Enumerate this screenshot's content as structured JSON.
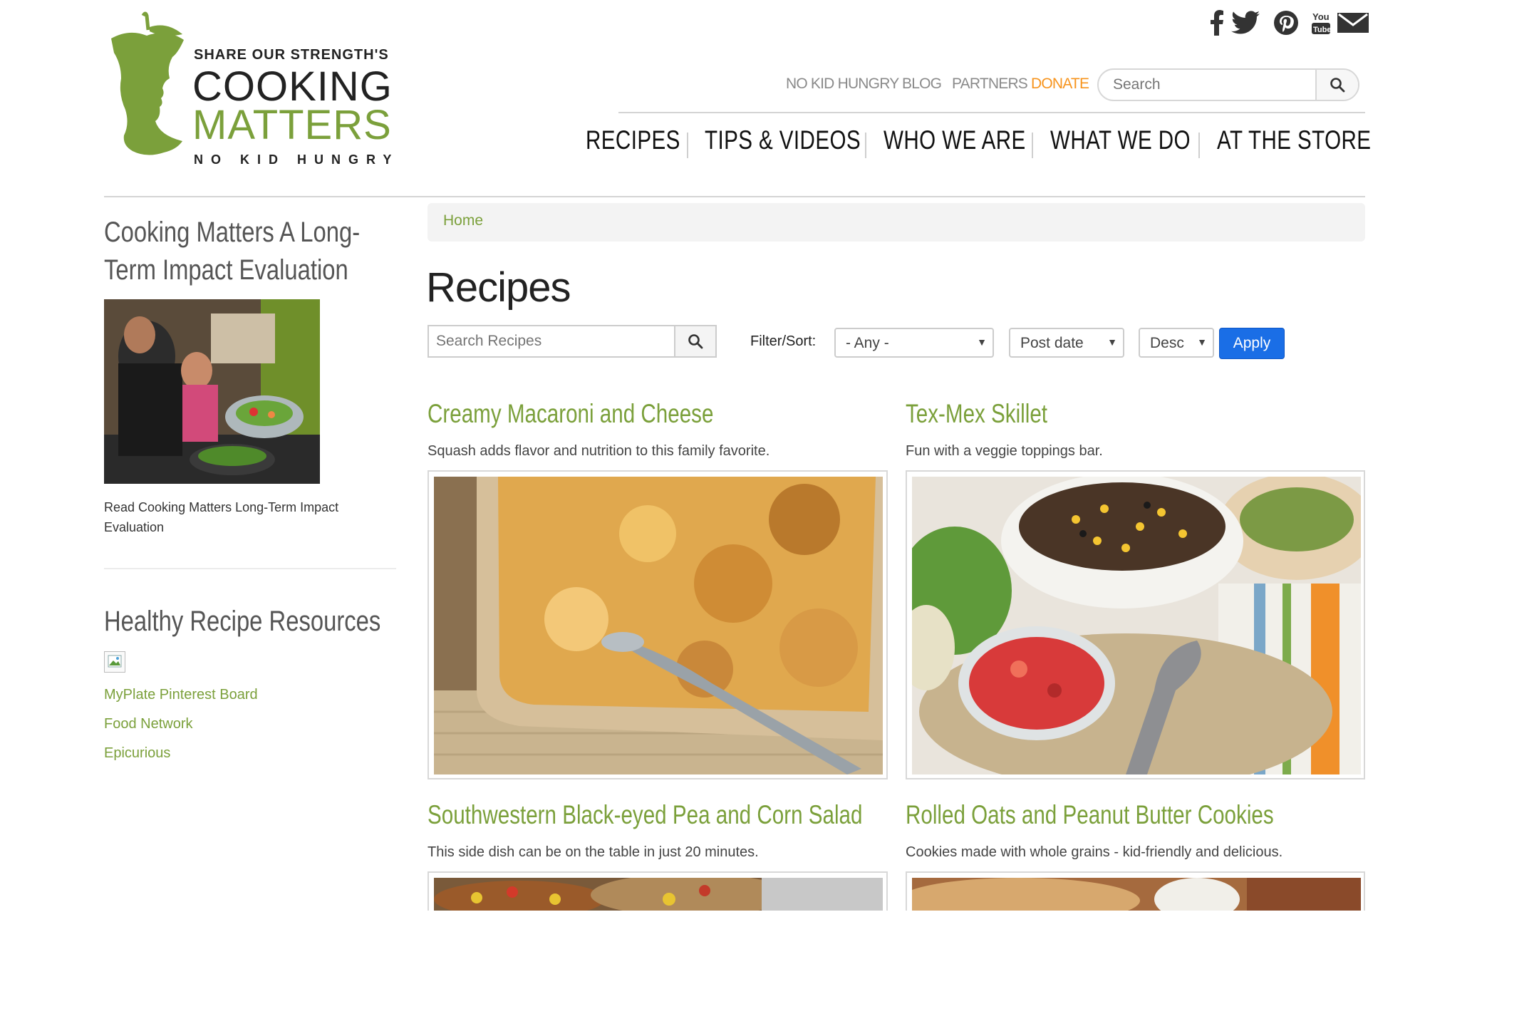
{
  "brand": {
    "line1": "SHARE OUR STRENGTH'S",
    "line2": "COOKING",
    "line3": "MATTERS",
    "line4": "NO KID HUNGRY",
    "color_green": "#7ba03b"
  },
  "social": [
    "facebook-icon",
    "twitter-icon",
    "pinterest-icon",
    "youtube-icon",
    "email-icon"
  ],
  "utility_nav": {
    "no_kid_hungry": "NO KID HUNGRY",
    "blog": "BLOG",
    "partners": "PARTNERS",
    "donate": "DONATE",
    "donate_color": "#f7941d"
  },
  "search": {
    "placeholder": "Search"
  },
  "main_nav": [
    "RECIPES",
    "TIPS & VIDEOS",
    "WHO WE ARE",
    "WHAT WE DO",
    "AT THE STORE"
  ],
  "sidebar": {
    "heading1": "Cooking Matters A Long-Term Impact Evaluation",
    "caption": "Read Cooking Matters Long-Term Impact Evaluation",
    "heading2": "Healthy Recipe Resources",
    "links": [
      "MyPlate Pinterest Board",
      "Food Network",
      "Epicurious"
    ]
  },
  "breadcrumb": {
    "home": "Home"
  },
  "page_title": "Recipes",
  "filters": {
    "search_placeholder": "Search Recipes",
    "label": "Filter/Sort:",
    "any": "- Any -",
    "sort_by": "Post date",
    "order": "Desc",
    "apply": "Apply",
    "apply_color": "#1a6ee6"
  },
  "recipes": [
    {
      "title": "Creamy Macaroni and Cheese",
      "desc": "Squash adds flavor and nutrition to this family favorite."
    },
    {
      "title": "Tex-Mex Skillet",
      "desc": "Fun with a veggie toppings bar."
    },
    {
      "title": "Southwestern Black-eyed Pea and Corn Salad",
      "desc": "This side dish can be on the table in just 20 minutes."
    },
    {
      "title": "Rolled Oats and Peanut Butter Cookies",
      "desc": "Cookies made with whole grains - kid-friendly and delicious."
    }
  ]
}
